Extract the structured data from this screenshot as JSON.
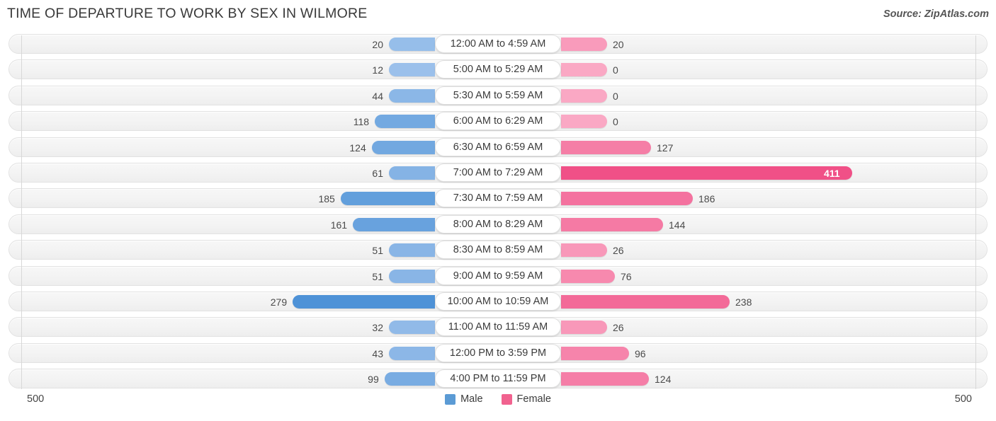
{
  "header": {
    "title": "TIME OF DEPARTURE TO WORK BY SEX IN WILMORE",
    "source": "Source: ZipAtlas.com"
  },
  "footer": {
    "axis_max_left": "500",
    "axis_max_right": "500",
    "legend": [
      {
        "label": "Male",
        "color": "#5b9bd5",
        "icon": "square-swatch"
      },
      {
        "label": "Female",
        "color": "#f1628f",
        "icon": "square-swatch"
      }
    ]
  },
  "chart_data": {
    "type": "bar",
    "subtype": "diverging-butterfly",
    "title": "TIME OF DEPARTURE TO WORK BY SEX IN WILMORE",
    "xlabel": "",
    "ylabel": "",
    "xlim": [
      0,
      500
    ],
    "grid": false,
    "legend_position": "bottom-center",
    "categories": [
      "12:00 AM to 4:59 AM",
      "5:00 AM to 5:29 AM",
      "5:30 AM to 5:59 AM",
      "6:00 AM to 6:29 AM",
      "6:30 AM to 6:59 AM",
      "7:00 AM to 7:29 AM",
      "7:30 AM to 7:59 AM",
      "8:00 AM to 8:29 AM",
      "8:30 AM to 8:59 AM",
      "9:00 AM to 9:59 AM",
      "10:00 AM to 10:59 AM",
      "11:00 AM to 11:59 AM",
      "12:00 PM to 3:59 PM",
      "4:00 PM to 11:59 PM"
    ],
    "series": [
      {
        "name": "Male",
        "color": "#5b9bd5",
        "direction": "left",
        "values": [
          20,
          12,
          44,
          118,
          124,
          61,
          185,
          161,
          51,
          51,
          279,
          32,
          43,
          99
        ]
      },
      {
        "name": "Female",
        "color": "#f1628f",
        "direction": "right",
        "values": [
          20,
          0,
          0,
          0,
          127,
          411,
          186,
          144,
          26,
          76,
          238,
          26,
          96,
          124
        ]
      }
    ]
  }
}
